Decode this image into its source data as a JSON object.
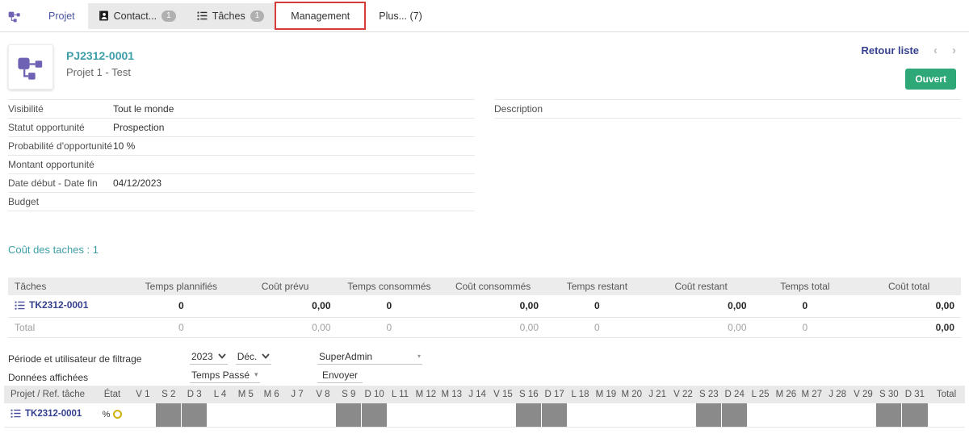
{
  "tabs": {
    "items": [
      {
        "key": "projet",
        "label": "Projet"
      },
      {
        "key": "contact",
        "label": "Contact...",
        "badge": "1",
        "icon": "contact-book-icon",
        "gray": true
      },
      {
        "key": "taches",
        "label": "Tâches",
        "badge": "1",
        "icon": "task-list-icon",
        "gray": true
      },
      {
        "key": "management",
        "label": "Management",
        "annotated": true
      },
      {
        "key": "plus",
        "label": "Plus... (7)"
      }
    ]
  },
  "header": {
    "code": "PJ2312-0001",
    "name": "Projet 1 - Test",
    "back_link": "Retour liste",
    "prev_icon": "‹",
    "next_icon": "›",
    "status_button": "Ouvert"
  },
  "details": {
    "left": [
      {
        "label": "Visibilité",
        "value": "Tout le monde"
      },
      {
        "label": "Statut opportunité",
        "value": "Prospection"
      },
      {
        "label": "Probabilité d'opportunité",
        "value": "10 %"
      },
      {
        "label": "Montant opportunité",
        "value": ""
      },
      {
        "label": "Date début - Date fin",
        "value": "04/12/2023"
      },
      {
        "label": "Budget",
        "value": ""
      }
    ],
    "right_label": "Description"
  },
  "cost_section": {
    "title": "Coût des taches : 1",
    "table": {
      "columns": [
        "Tâches",
        "Temps plannifiés",
        "Coût prévu",
        "Temps consommés",
        "Coût consommés",
        "Temps restant",
        "Coût restant",
        "Temps total",
        "Coût total"
      ],
      "rows": [
        {
          "task": "TK2312-0001",
          "is_link": true,
          "values": [
            "0",
            "0,00",
            "0",
            "0,00",
            "0",
            "0,00",
            "0",
            "0,00"
          ]
        },
        {
          "task": "Total",
          "is_link": false,
          "values": [
            "0",
            "0,00",
            "0",
            "0,00",
            "0",
            "0,00",
            "0",
            "0,00"
          ]
        }
      ]
    }
  },
  "filters": {
    "period_label": "Période et utilisateur de filtrage",
    "year": "2023",
    "month": "Déc.",
    "user": "SuperAdmin",
    "data_label": "Données affichées",
    "data_value": "Temps Passé",
    "submit_label": "Envoyer"
  },
  "calendar": {
    "columns": {
      "task": "Projet / Ref. tâche",
      "state": "État",
      "total": "Total"
    },
    "days": [
      {
        "label": "V 1",
        "weekend": false
      },
      {
        "label": "S 2",
        "weekend": true
      },
      {
        "label": "D 3",
        "weekend": true
      },
      {
        "label": "L 4",
        "weekend": false
      },
      {
        "label": "M 5",
        "weekend": false
      },
      {
        "label": "M 6",
        "weekend": false
      },
      {
        "label": "J 7",
        "weekend": false
      },
      {
        "label": "V 8",
        "weekend": false
      },
      {
        "label": "S 9",
        "weekend": true
      },
      {
        "label": "D 10",
        "weekend": true
      },
      {
        "label": "L 11",
        "weekend": false
      },
      {
        "label": "M 12",
        "weekend": false
      },
      {
        "label": "M 13",
        "weekend": false
      },
      {
        "label": "J 14",
        "weekend": false
      },
      {
        "label": "V 15",
        "weekend": false
      },
      {
        "label": "S 16",
        "weekend": true
      },
      {
        "label": "D 17",
        "weekend": true
      },
      {
        "label": "L 18",
        "weekend": false
      },
      {
        "label": "M 19",
        "weekend": false
      },
      {
        "label": "M 20",
        "weekend": false
      },
      {
        "label": "J 21",
        "weekend": false
      },
      {
        "label": "V 22",
        "weekend": false
      },
      {
        "label": "S 23",
        "weekend": true
      },
      {
        "label": "D 24",
        "weekend": true
      },
      {
        "label": "L 25",
        "weekend": false
      },
      {
        "label": "M 26",
        "weekend": false
      },
      {
        "label": "M 27",
        "weekend": false
      },
      {
        "label": "J 28",
        "weekend": false
      },
      {
        "label": "V 29",
        "weekend": false
      },
      {
        "label": "S 30",
        "weekend": true
      },
      {
        "label": "D 31",
        "weekend": true
      }
    ],
    "row": {
      "task": "TK2312-0001",
      "state": "%"
    }
  },
  "colors": {
    "accent_teal": "#3d9ea8",
    "link_navy": "#35418f",
    "status_green": "#2ea876",
    "brand_purple": "#6e62b5",
    "annotation_red": "#d53b3b",
    "weekend_gray": "#8a8a8a",
    "state_yellow": "#d2b10e"
  }
}
